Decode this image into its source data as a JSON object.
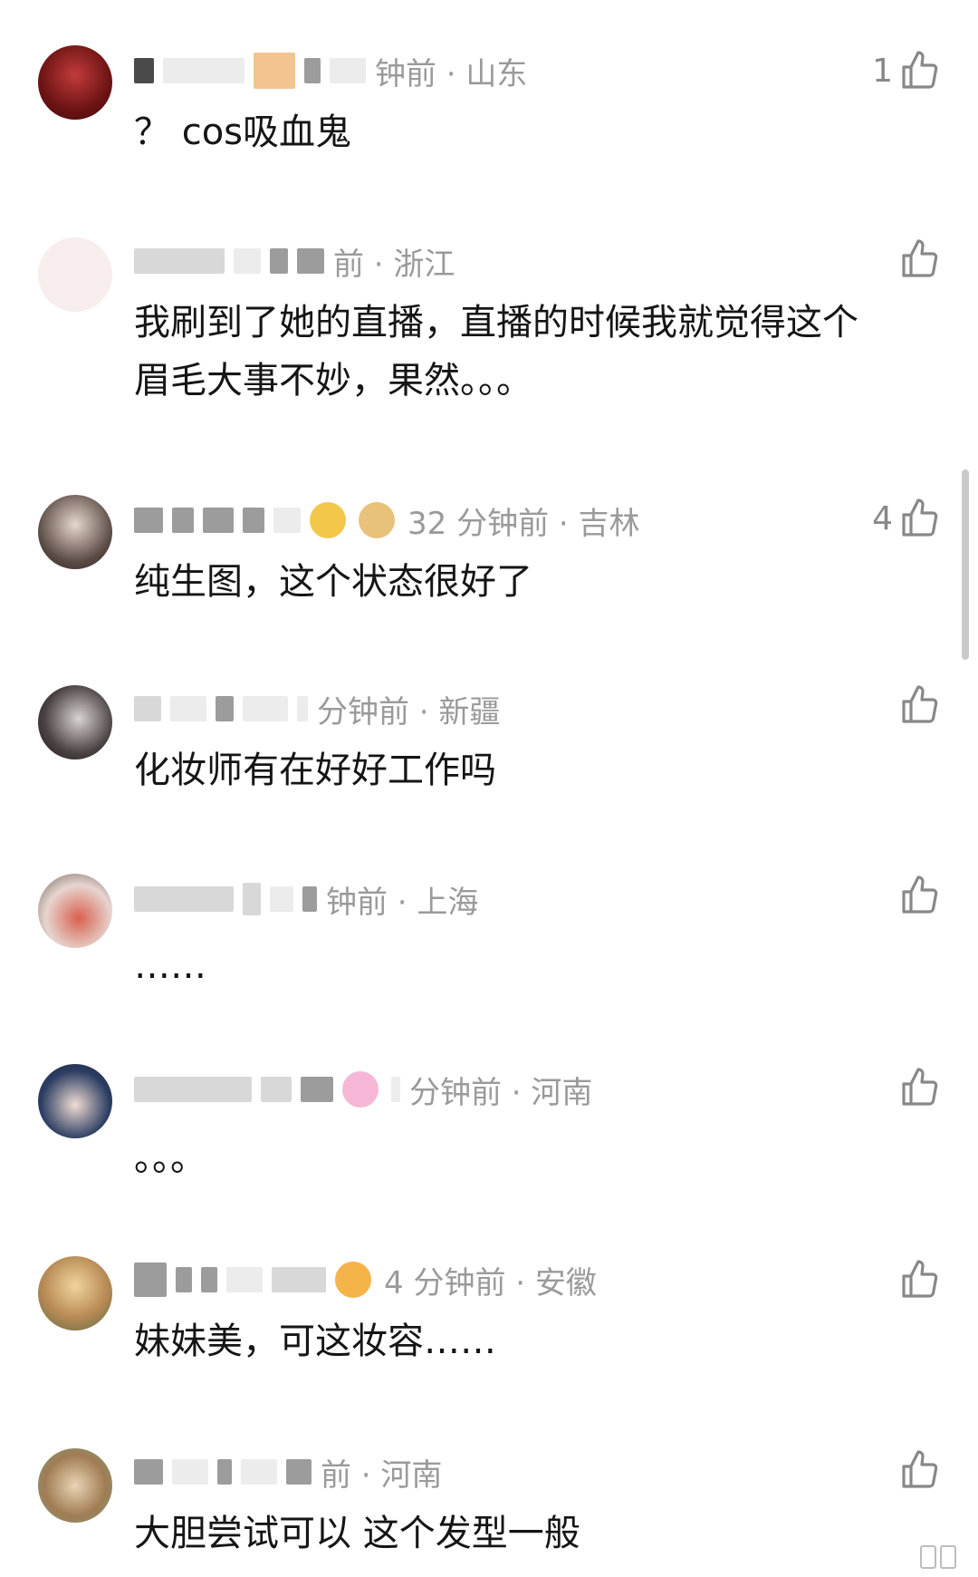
{
  "comments": [
    {
      "meta": "钟前 · 山东",
      "text": "？ cos吸血鬼",
      "likes": "1"
    },
    {
      "meta": "前 · 浙江",
      "text_lines": [
        "我刷到了她的直播，直播的时候我就觉得这个",
        "眉毛大事不妙，果然。。。"
      ],
      "likes": ""
    },
    {
      "meta": "32 分钟前 · 吉林",
      "text": "纯生图，这个状态很好了",
      "likes": "4"
    },
    {
      "meta": "分钟前 · 新疆",
      "text": "化妆师有在好好工作吗",
      "likes": ""
    },
    {
      "meta": "钟前 · 上海",
      "text": "……",
      "likes": ""
    },
    {
      "meta": "分钟前 · 河南",
      "text": "。。。",
      "likes": ""
    },
    {
      "meta": "4 分钟前 · 安徽",
      "text": "妹妹美，可这妆容……",
      "likes": ""
    },
    {
      "meta": "前 · 河南",
      "text": "大胆尝试可以 这个发型一般",
      "likes": ""
    }
  ],
  "icons": {
    "like": "thumbs-up-icon",
    "avatar": "avatar"
  },
  "colors": {
    "meta": "#9a9a9a",
    "text": "#151515",
    "icon": "#888888"
  }
}
